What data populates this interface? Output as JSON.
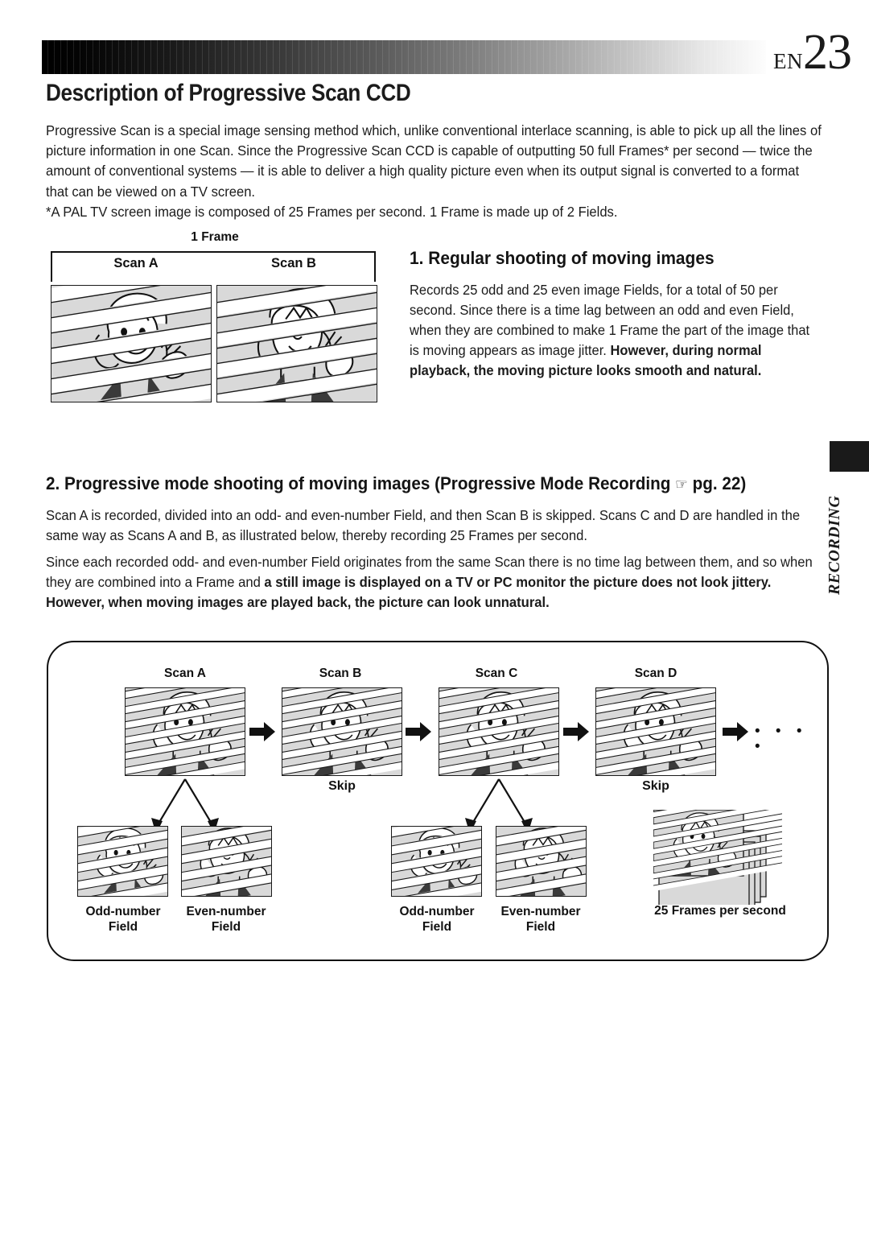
{
  "header": {
    "en_prefix": "EN",
    "page_number": "23",
    "title": "Description of Progressive Scan CCD"
  },
  "intro": {
    "paragraph": "Progressive Scan is a special image sensing method which, unlike conventional interlace scanning, is able to pick up all the lines of picture information in one Scan.  Since the Progressive Scan CCD is capable of outputting 50 full Frames* per second — twice the amount of conventional systems — it is able to deliver a high quality picture even when its output signal is converted to a format that can be viewed on a TV screen.",
    "footnote": "*A PAL TV screen image is composed of 25 Frames per second. 1 Frame is made up of 2 Fields."
  },
  "section1": {
    "heading": "1. Regular shooting of moving images",
    "body_plain": "Records 25 odd and 25 even image Fields, for a total of 50 per second.  Since there is a time lag between an odd and even Field, when they are combined to make 1 Frame the part of the image that is moving appears as image jitter. ",
    "body_bold": "However, during normal playback, the moving picture looks smooth and natural."
  },
  "frame_diagram": {
    "frame_label": "1 Frame",
    "scan_a_label": "Scan A",
    "scan_b_label": "Scan B"
  },
  "section2": {
    "heading_before": "2. Progressive mode shooting of moving images (Progressive Mode Recording ",
    "heading_icon": "☞",
    "heading_after": " pg. 22)",
    "para1": "Scan A is recorded, divided into an odd- and even-number Field, and then Scan B is skipped.  Scans C and D are handled in the same way as Scans A and B, as illustrated below, thereby recording 25 Frames per second.",
    "para2_plain": "Since each recorded odd- and even-number Field originates from the same Scan there is no time lag  between them, and so when they are combined into a Frame and ",
    "para2_bold": "a still image is displayed on a TV or PC monitor the picture does not look jittery.  However, when moving images are played back, the picture can look unnatural."
  },
  "side_tab": {
    "label": "RECORDING"
  },
  "progressive_diagram": {
    "scans": [
      {
        "label": "Scan A",
        "note": ""
      },
      {
        "label": "Scan B",
        "note": "Skip"
      },
      {
        "label": "Scan C",
        "note": ""
      },
      {
        "label": "Scan D",
        "note": "Skip"
      }
    ],
    "fields_group1": [
      {
        "label": "Odd-number\nField"
      },
      {
        "label": "Even-number\nField"
      }
    ],
    "fields_group2": [
      {
        "label": "Odd-number\nField"
      },
      {
        "label": "Even-number\nField"
      }
    ],
    "odd_label_1": "Odd-number",
    "field_word_1": "Field",
    "even_label_1": "Even-number",
    "field_word_2": "Field",
    "odd_label_2": "Odd-number",
    "field_word_3": "Field",
    "even_label_2": "Even-number",
    "field_word_4": "Field",
    "skip_1": "Skip",
    "skip_2": "Skip",
    "result_label": "25 Frames per second",
    "continuation_dots": "• • • •"
  },
  "colors": {
    "ink": "#1a1a1a",
    "scanline_gray": "#d9d9d9",
    "shadow_dark": "#3a3a3a"
  }
}
